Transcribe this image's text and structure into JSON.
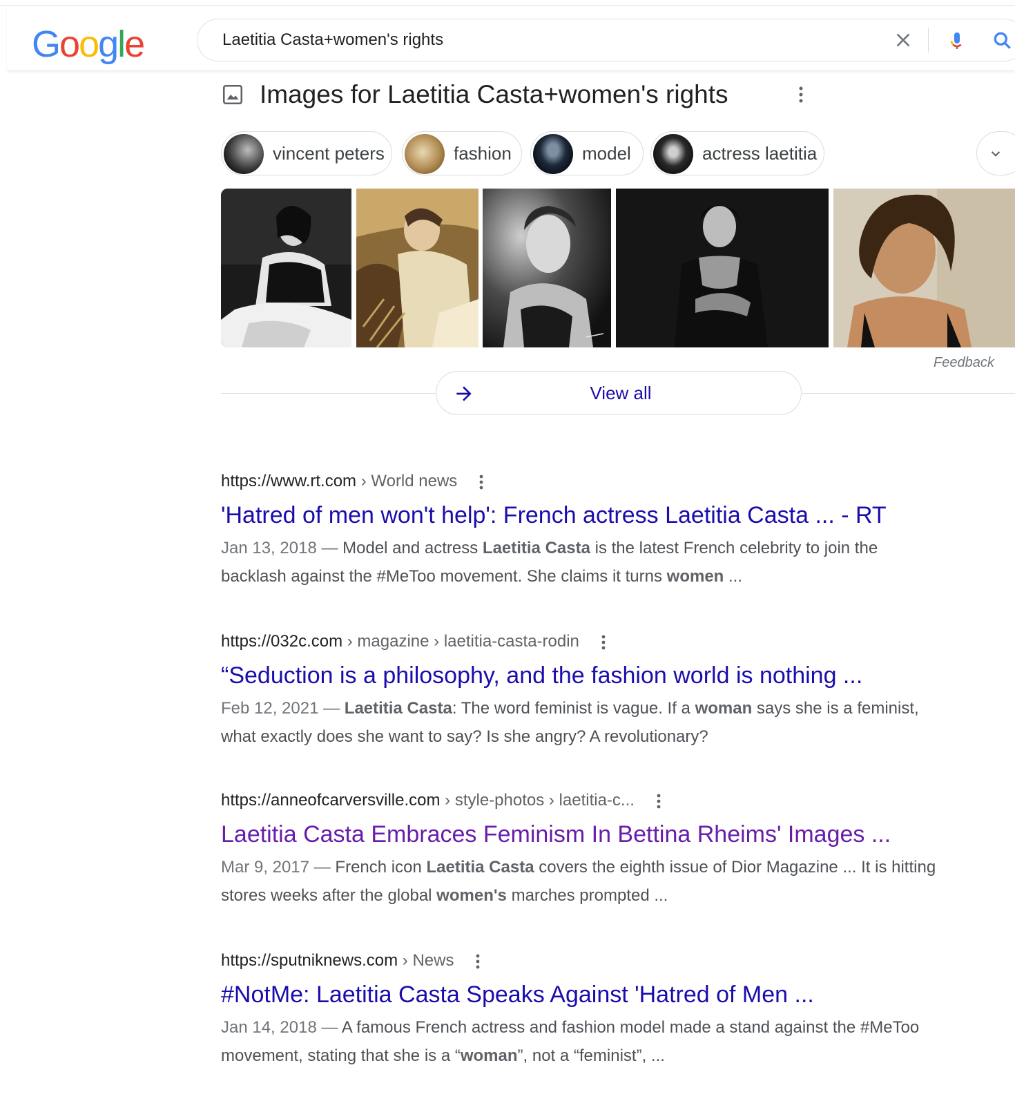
{
  "logo": {
    "text": "Google",
    "letters": [
      "G",
      "o",
      "o",
      "g",
      "l",
      "e"
    ]
  },
  "search": {
    "query": "Laetitia Casta+women's rights"
  },
  "images_section": {
    "title": "Images for Laetitia Casta+women's rights",
    "chips": [
      "vincent peters",
      "fashion",
      "model",
      "actress laetitia"
    ],
    "feedback": "Feedback",
    "view_all": "View all"
  },
  "results": [
    {
      "domain": "https://www.rt.com",
      "path": " › World news",
      "title": "'Hatred of men won't help': French actress Laetitia Casta ... - RT",
      "date": "Jan 13, 2018 — ",
      "line1": [
        {
          "t": "Model and actress "
        },
        {
          "t": "Laetitia Casta",
          "b": true
        },
        {
          "t": " is the latest French celebrity to join the"
        }
      ],
      "line2": [
        {
          "t": "backlash against the #MeToo movement. She claims it turns "
        },
        {
          "t": "women",
          "b": true
        },
        {
          "t": " ..."
        }
      ]
    },
    {
      "domain": "https://032c.com",
      "path": " › magazine › laetitia-casta-rodin",
      "title": "“Seduction is a philosophy, and the fashion world is nothing ...",
      "date": "Feb 12, 2021 — ",
      "line1": [
        {
          "t": "Laetitia Casta",
          "b": true
        },
        {
          "t": ": The word feminist is vague. If a "
        },
        {
          "t": "woman",
          "b": true
        },
        {
          "t": " says she is a feminist,"
        }
      ],
      "line2": [
        {
          "t": "what exactly does she want to say? Is she angry? A revolutionary?"
        }
      ]
    },
    {
      "domain": "https://anneofcarversville.com",
      "path": " › style-photos › laetitia-c...",
      "title": "Laetitia Casta Embraces Feminism In Bettina Rheims' Images ...",
      "visited": true,
      "date": "Mar 9, 2017 — ",
      "line1": [
        {
          "t": "French icon "
        },
        {
          "t": "Laetitia Casta",
          "b": true
        },
        {
          "t": " covers the eighth issue of Dior Magazine ... It is hitting"
        }
      ],
      "line2": [
        {
          "t": "stores weeks after the global "
        },
        {
          "t": "women's",
          "b": true
        },
        {
          "t": " marches prompted ..."
        }
      ]
    },
    {
      "domain": "https://sputniknews.com",
      "path": " › News",
      "title": "#NotMe: Laetitia Casta Speaks Against 'Hatred of Men ...",
      "date": "Jan 14, 2018 — ",
      "line1": [
        {
          "t": "A famous French actress and fashion model made a stand against the #MeToo"
        }
      ],
      "line2": [
        {
          "t": "movement, stating that she is a “"
        },
        {
          "t": "woman",
          "b": true
        },
        {
          "t": "”, not a “feminist”, ..."
        }
      ]
    }
  ],
  "colors": {
    "link": "#1a0dab",
    "visited": "#681da8",
    "google_blue": "#4285f4",
    "google_red": "#ea4335",
    "google_yellow": "#fbbc05",
    "google_green": "#34a853"
  },
  "icons": [
    "clear-icon",
    "mic-icon",
    "lens-icon",
    "image-icon",
    "more-vert-icon",
    "arrow-right-icon",
    "chevron-down-icon"
  ]
}
